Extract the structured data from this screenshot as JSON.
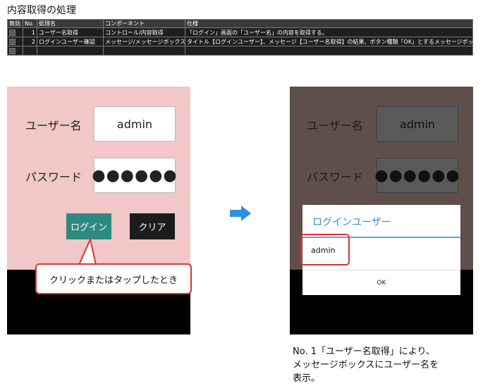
{
  "title": "内容取得の処理",
  "table": {
    "headers": [
      "無効",
      "No.",
      "処理名",
      "コンポーネント",
      "仕様"
    ],
    "rows": [
      {
        "no": "1",
        "name": "ユーザー名取得",
        "component": "コントロール/内容取得",
        "spec": "「ログイン」画面の「ユーザー名」の内容を取得する。"
      },
      {
        "no": "2",
        "name": "ログインユーザー確認",
        "component": "メッセージ/メッセージボックス表示",
        "spec": "タイトル【ログインユーザー】、メッセージ【ユーザー名取得】の結果、ボタン種類「OK」とするメッセージボックスを表示する。"
      },
      {
        "no": "",
        "name": "",
        "component": "",
        "spec": ""
      }
    ]
  },
  "left_screen": {
    "username_label": "ユーザー名",
    "username_value": "admin",
    "password_label": "パスワード",
    "password_value": "●●●●●●",
    "login_button": "ログイン",
    "clear_button": "クリア"
  },
  "callout": "クリックまたはタップしたとき",
  "right_screen": {
    "username_label": "ユーザー名",
    "username_value": "admin",
    "password_label": "パスワード",
    "password_value": "●●●●●●",
    "dialog": {
      "title": "ログインユーザー",
      "message": "admin",
      "ok_button": "OK"
    }
  },
  "note_lines": [
    "No. 1「ユーザー名取得」により、",
    "メッセージボックスにユーザー名を",
    "表示。"
  ],
  "colors": {
    "left_bg": "#f1c7c7",
    "right_bg": "#5e4f4a",
    "login_button": "#2e8a80",
    "arrow": "#2f8fe0",
    "highlight": "#dd3333",
    "dialog_accent": "#3a8fd0"
  },
  "icons": {
    "arrow": "right-arrow-icon"
  }
}
